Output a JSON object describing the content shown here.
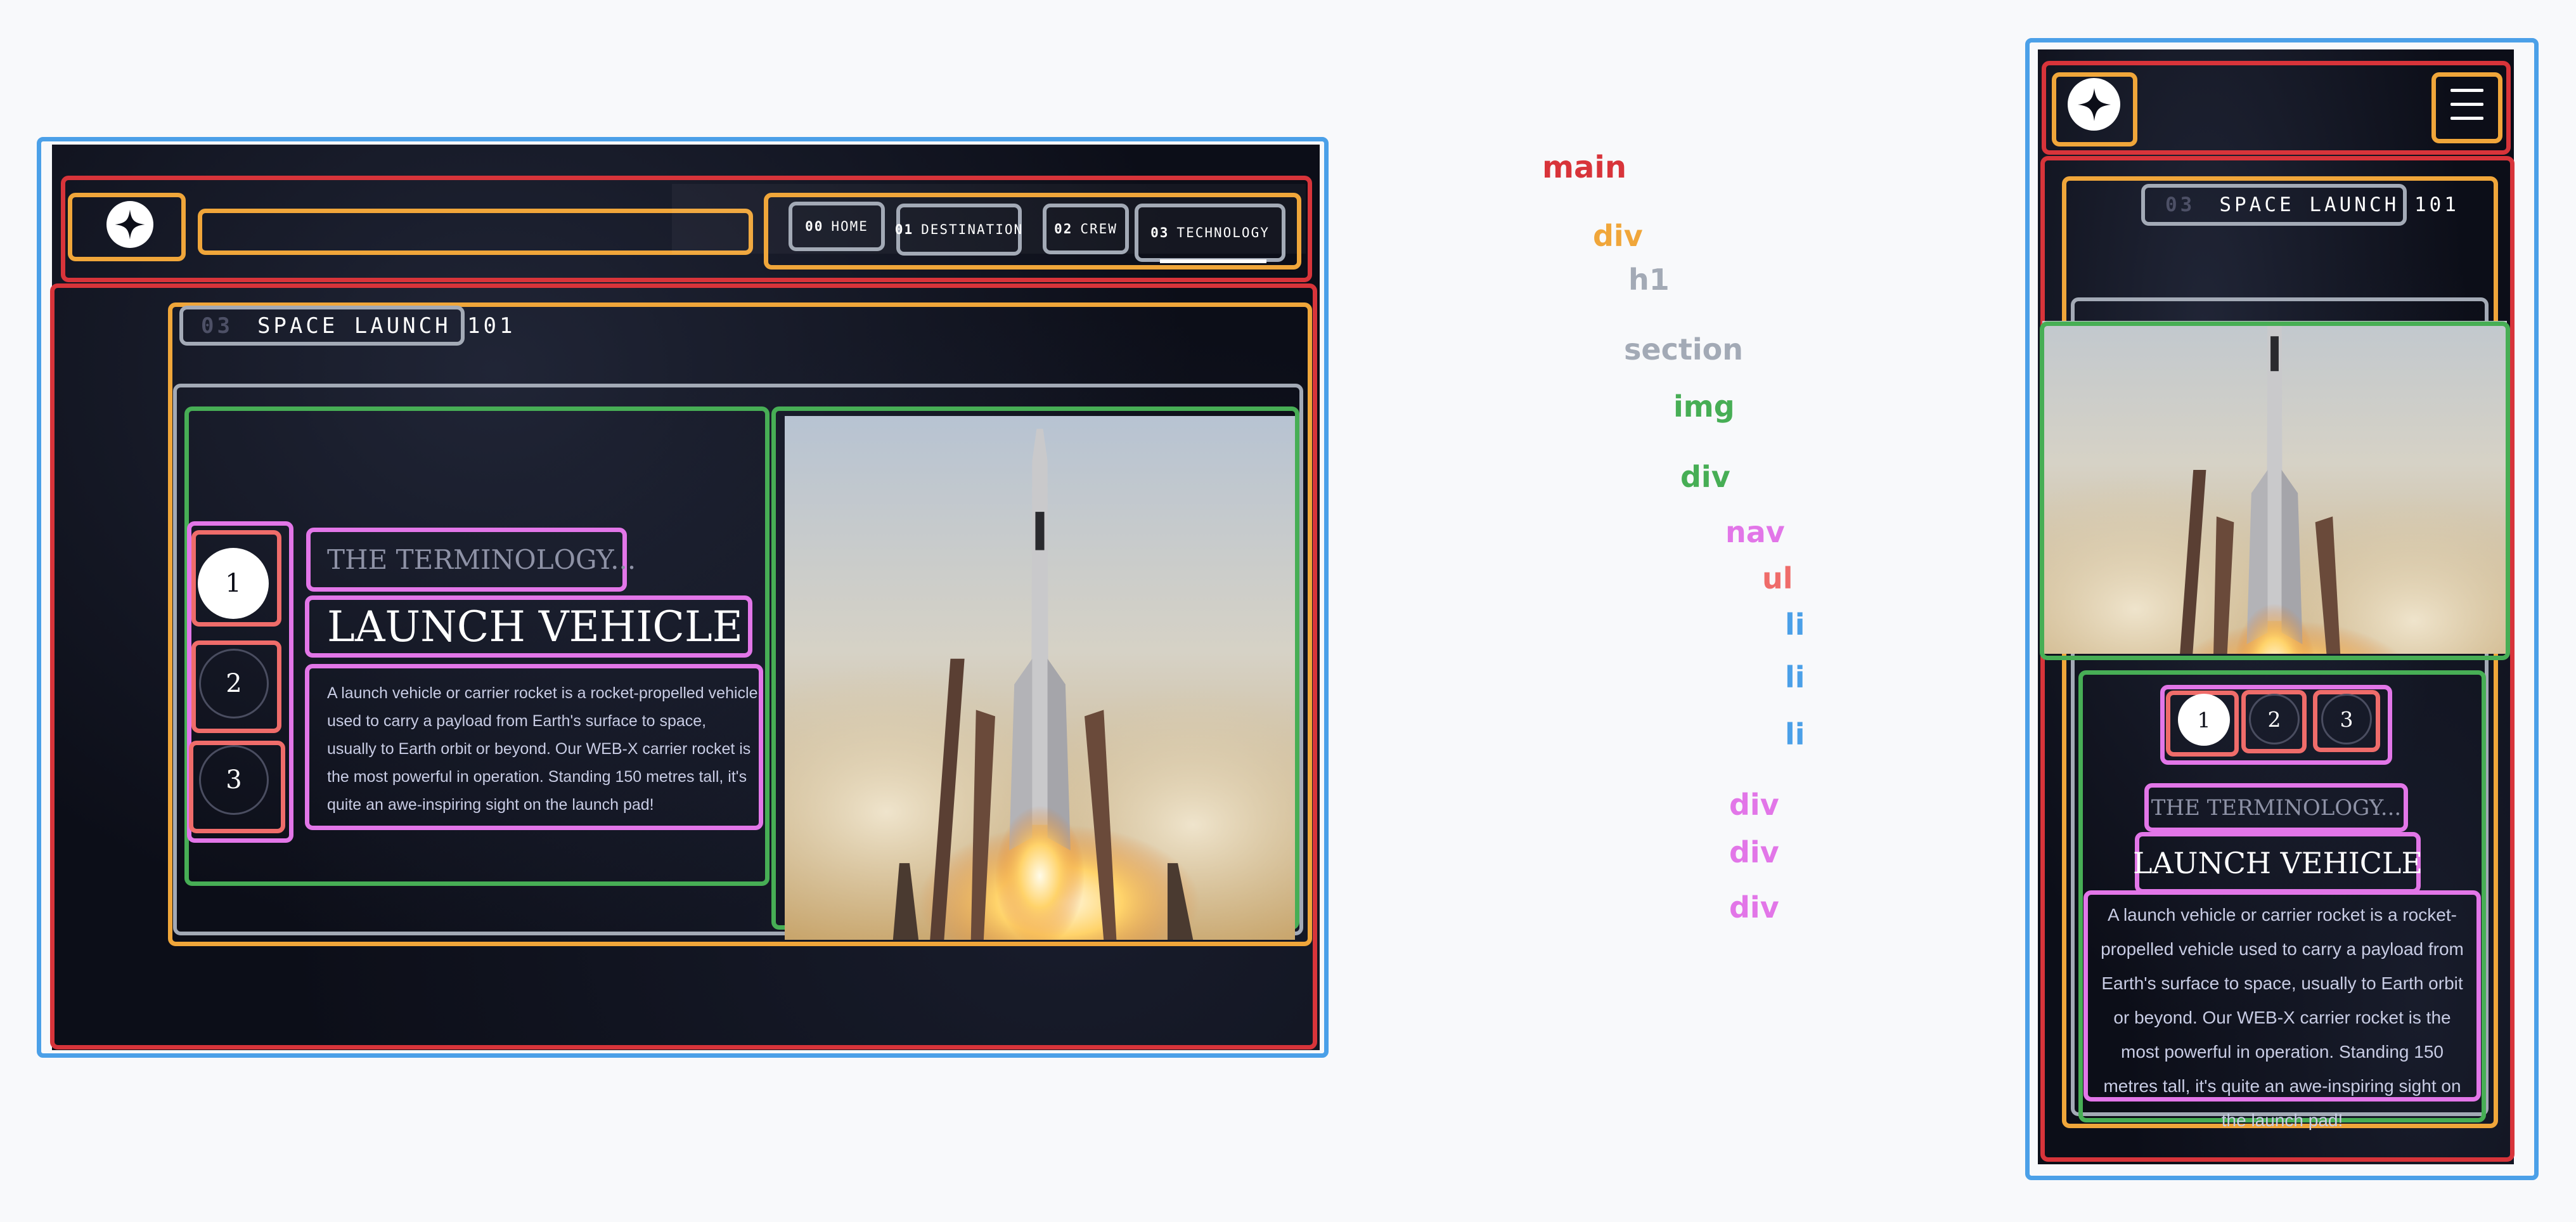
{
  "nav": {
    "links": [
      {
        "num": "00",
        "label": "HOME"
      },
      {
        "num": "01",
        "label": "DESTINATION"
      },
      {
        "num": "02",
        "label": "CREW"
      },
      {
        "num": "03",
        "label": "TECHNOLOGY"
      }
    ]
  },
  "page": {
    "heading_num": "03",
    "heading_text": "SPACE LAUNCH 101"
  },
  "tech": {
    "pages": [
      "1",
      "2",
      "3"
    ],
    "active_page": "1",
    "terminology": "THE TERMINOLOGY...",
    "name": "LAUNCH VEHICLE",
    "description": "A launch vehicle or carrier rocket is a rocket-propelled vehicle used to carry a payload from Earth's surface to space, usually to Earth orbit or beyond. Our WEB-X carrier rocket is the most powerful in operation. Standing 150 metres tall, it's quite an awe-inspiring sight on the launch pad!"
  },
  "legend": [
    {
      "label": "main",
      "color": "#d8343a"
    },
    {
      "label": "div",
      "color": "#f0a63a"
    },
    {
      "label": "h1",
      "color": "#a3aab6"
    },
    {
      "label": "section",
      "color": "#a3aab6"
    },
    {
      "label": "img",
      "color": "#47ae55"
    },
    {
      "label": "div",
      "color": "#47ae55"
    },
    {
      "label": "nav",
      "color": "#e276e8"
    },
    {
      "label": "ul",
      "color": "#ef6c6a"
    },
    {
      "label": "li",
      "color": "#4ba0e8"
    },
    {
      "label": "li",
      "color": "#4ba0e8"
    },
    {
      "label": "li",
      "color": "#4ba0e8"
    },
    {
      "label": "div",
      "color": "#e276e8"
    },
    {
      "label": "div",
      "color": "#e276e8"
    },
    {
      "label": "div",
      "color": "#e276e8"
    }
  ]
}
